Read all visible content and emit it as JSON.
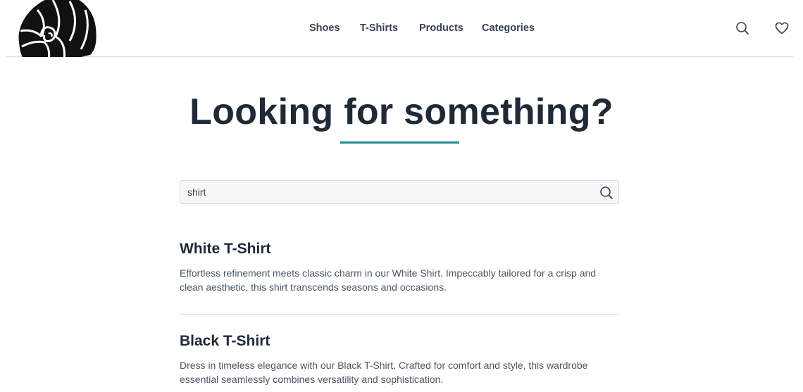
{
  "header": {
    "nav": [
      {
        "label": "Shoes"
      },
      {
        "label": "T-Shirts"
      },
      {
        "label": "Products"
      },
      {
        "label": "Categories"
      }
    ],
    "icons": [
      "search-icon",
      "heart-icon"
    ]
  },
  "hero": {
    "title": "Looking for something?",
    "accent_color": "#1b8a8f"
  },
  "search": {
    "value": "shirt",
    "placeholder": ""
  },
  "results": [
    {
      "title": "White T-Shirt",
      "description": "Effortless refinement meets classic charm in our White Shirt. Impeccably tailored for a crisp and clean aesthetic, this shirt transcends seasons and occasions."
    },
    {
      "title": "Black T-Shirt",
      "description": "Dress in timeless elegance with our Black T-Shirt. Crafted for comfort and style, this wardrobe essential seamlessly combines versatility and sophistication."
    }
  ]
}
